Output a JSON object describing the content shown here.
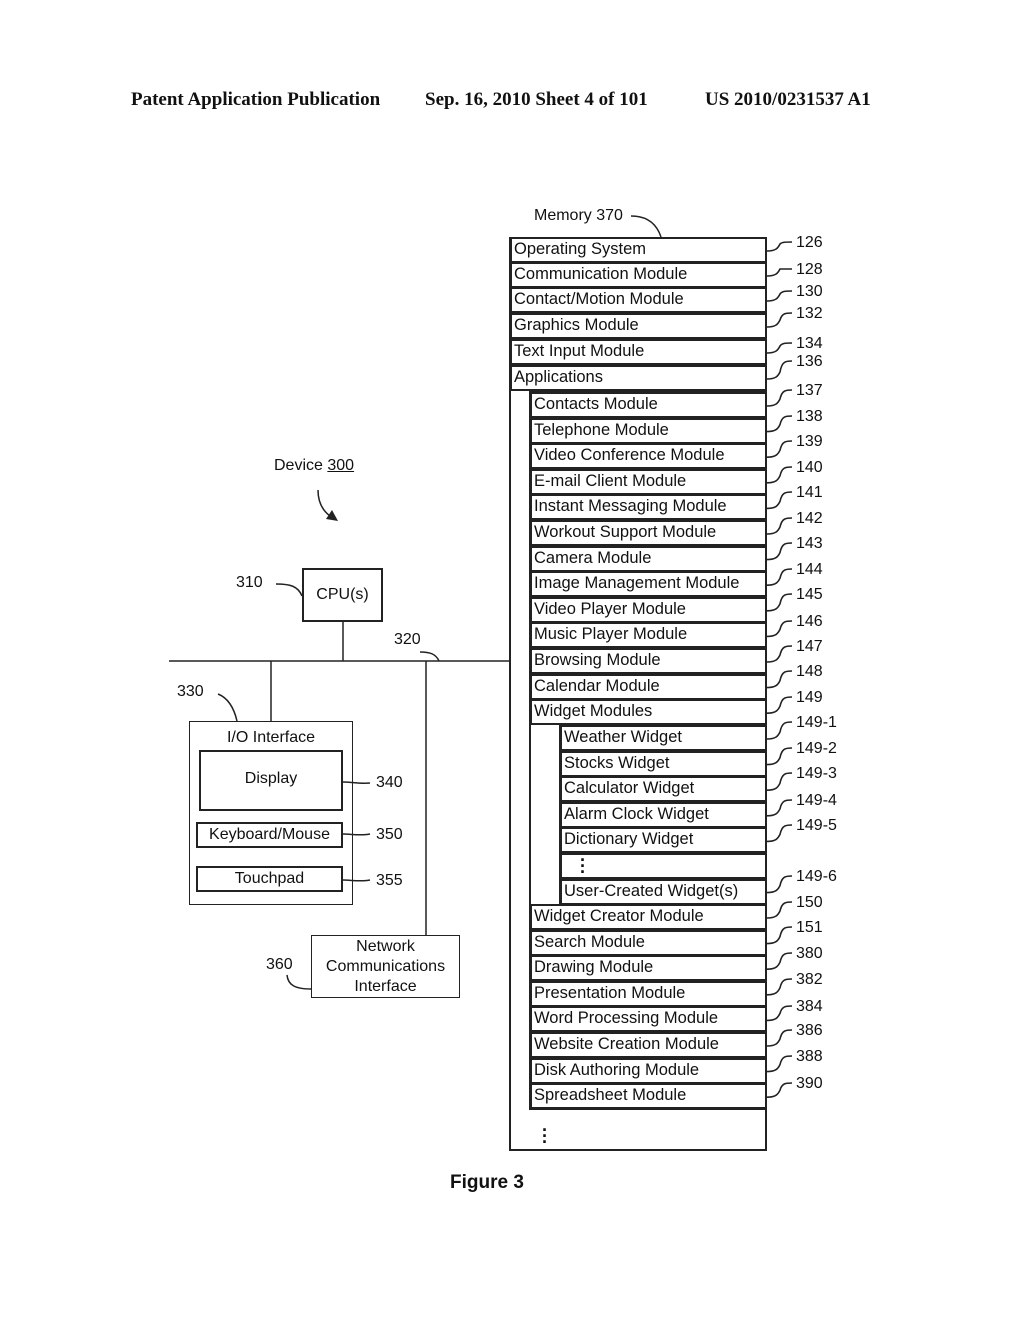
{
  "header": {
    "publication": "Patent Application Publication",
    "date_sheet": "Sep. 16, 2010   Sheet 4 of 101",
    "patent_number": "US 2010/0231537 A1"
  },
  "device": {
    "label": "Device",
    "number": "300",
    "cpu": {
      "label": "CPU(s)",
      "ref": "310"
    },
    "bus_ref": "320",
    "io": {
      "ref": "330",
      "title": "I/O Interface",
      "display": {
        "label": "Display",
        "ref": "340"
      },
      "keyboard": {
        "label": "Keyboard/Mouse",
        "ref": "350"
      },
      "touchpad": {
        "label": "Touchpad",
        "ref": "355"
      }
    },
    "network": {
      "ref": "360",
      "line1": "Network",
      "line2": "Communications",
      "line3": "Interface"
    }
  },
  "memory": {
    "title": "Memory 370",
    "top_rows": [
      {
        "label": "Operating System",
        "ref": "126"
      },
      {
        "label": "Communication Module",
        "ref": "128"
      },
      {
        "label": "Contact/Motion Module",
        "ref": "130"
      },
      {
        "label": "Graphics Module",
        "ref": "132"
      },
      {
        "label": "Text Input Module",
        "ref": "134"
      },
      {
        "label": "Applications",
        "ref": "136"
      }
    ],
    "apps": [
      {
        "label": "Contacts Module",
        "ref": "137"
      },
      {
        "label": "Telephone Module",
        "ref": "138"
      },
      {
        "label": "Video Conference Module",
        "ref": "139"
      },
      {
        "label": "E-mail Client Module",
        "ref": "140"
      },
      {
        "label": "Instant Messaging Module",
        "ref": "141"
      },
      {
        "label": "Workout Support Module",
        "ref": "142"
      },
      {
        "label": "Camera Module",
        "ref": "143"
      },
      {
        "label": "Image Management Module",
        "ref": "144"
      },
      {
        "label": "Video Player Module",
        "ref": "145"
      },
      {
        "label": "Music Player Module",
        "ref": "146"
      },
      {
        "label": "Browsing Module",
        "ref": "147"
      },
      {
        "label": "Calendar Module",
        "ref": "148"
      },
      {
        "label": "Widget Modules",
        "ref": "149"
      }
    ],
    "widgets": [
      {
        "label": "Weather Widget",
        "ref": "149-1"
      },
      {
        "label": "Stocks Widget",
        "ref": "149-2"
      },
      {
        "label": "Calculator Widget",
        "ref": "149-3"
      },
      {
        "label": "Alarm Clock Widget",
        "ref": "149-4"
      },
      {
        "label": "Dictionary Widget",
        "ref": "149-5"
      },
      {
        "label": "",
        "ref": ""
      },
      {
        "label": "User-Created Widget(s)",
        "ref": "149-6"
      }
    ],
    "more_apps": [
      {
        "label": "Widget Creator Module",
        "ref": "150"
      },
      {
        "label": "Search Module",
        "ref": "151"
      },
      {
        "label": "Drawing Module",
        "ref": "380"
      },
      {
        "label": "Presentation Module",
        "ref": "382"
      },
      {
        "label": "Word Processing  Module",
        "ref": "384"
      },
      {
        "label": "Website Creation Module",
        "ref": "386"
      },
      {
        "label": "Disk Authoring Module",
        "ref": "388"
      },
      {
        "label": "Spreadsheet Module",
        "ref": "390"
      }
    ]
  },
  "caption": "Figure 3"
}
